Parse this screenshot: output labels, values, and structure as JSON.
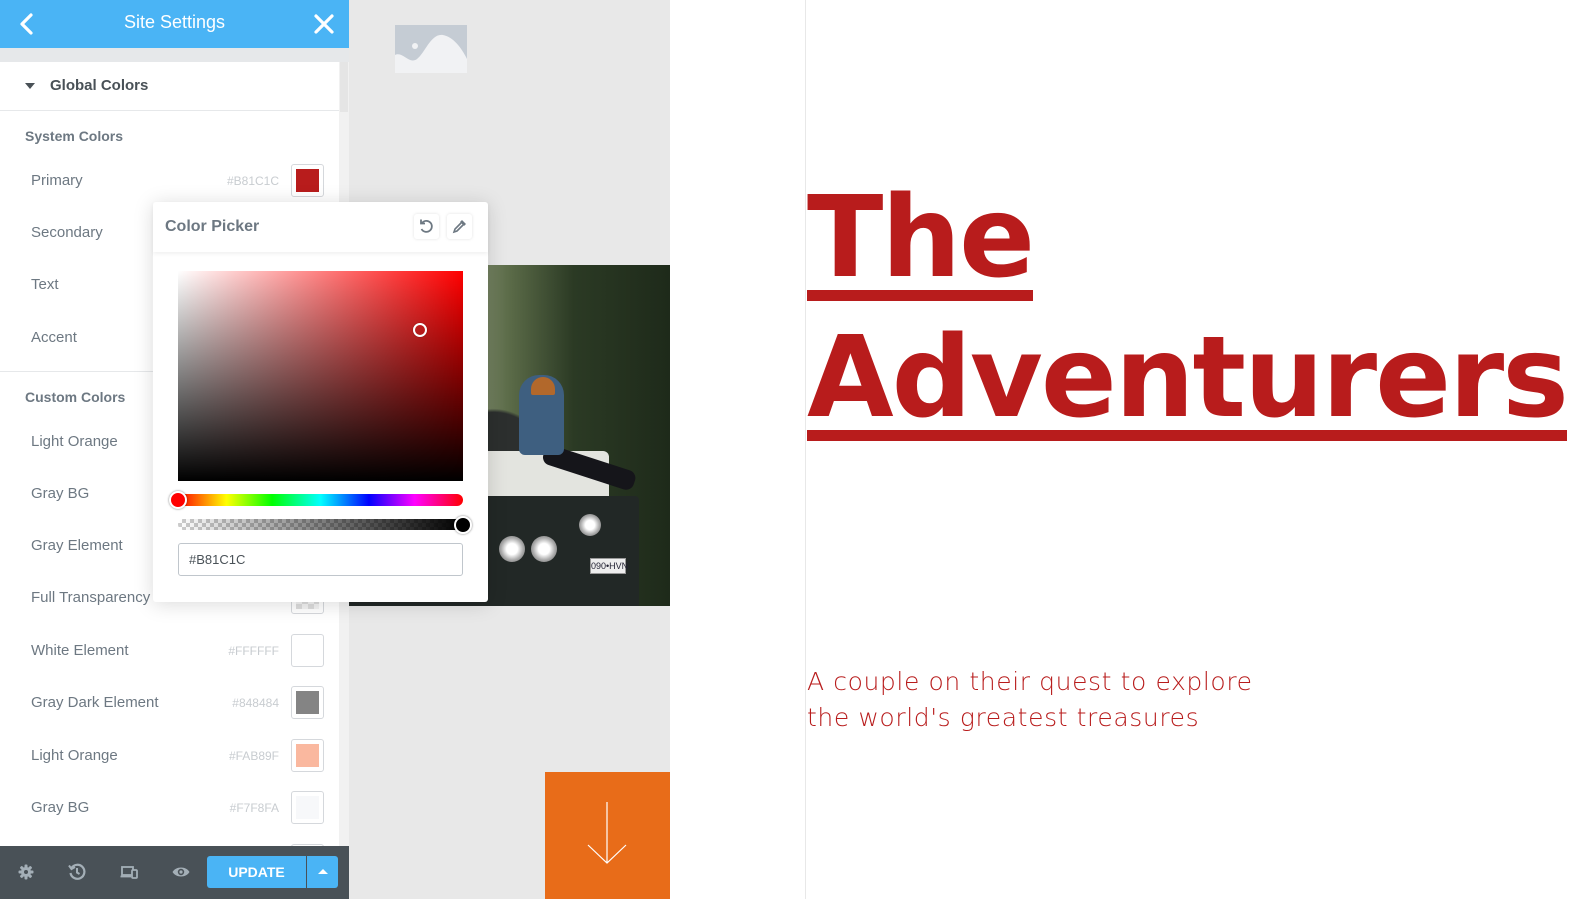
{
  "sidebar": {
    "header": {
      "title": "Site Settings",
      "back_icon": "chevron-left-icon",
      "close_icon": "close-icon"
    },
    "section": {
      "label": "Global Colors",
      "expanded": true
    },
    "system_colors": {
      "title": "System Colors",
      "items": [
        {
          "name": "Primary",
          "hex": "#B81C1C",
          "color": "#B81C1C"
        },
        {
          "name": "Secondary",
          "hex": "",
          "color": ""
        },
        {
          "name": "Text",
          "hex": "",
          "color": ""
        },
        {
          "name": "Accent",
          "hex": "",
          "color": ""
        }
      ]
    },
    "custom_colors": {
      "title": "Custom Colors",
      "items": [
        {
          "name": "Light Orange",
          "hex": "",
          "color": ""
        },
        {
          "name": "Gray BG",
          "hex": "",
          "color": ""
        },
        {
          "name": "Gray Element",
          "hex": "",
          "color": ""
        },
        {
          "name": "Full Transparency",
          "hex": "",
          "color": ""
        },
        {
          "name": "White Element",
          "hex": "#FFFFFF",
          "color": "#FFFFFF"
        },
        {
          "name": "Gray Dark Element",
          "hex": "#848484",
          "color": "#848484"
        },
        {
          "name": "Light Orange",
          "hex": "#FAB89F",
          "color": "#FAB89F"
        },
        {
          "name": "Gray BG",
          "hex": "#F7F8FA",
          "color": "#F7F8FA"
        }
      ]
    },
    "footer": {
      "icons": [
        "settings-icon",
        "history-icon",
        "responsive-icon",
        "preview-eye-icon"
      ],
      "update_label": "UPDATE",
      "update_more_icon": "caret-up-icon"
    }
  },
  "color_picker": {
    "title": "Color Picker",
    "reset_icon": "reset-icon",
    "eyedropper_icon": "eyedropper-icon",
    "hex_value": "#B81C1C",
    "hue": 0,
    "saturation": 0.85,
    "brightness": 0.72,
    "alpha": 1
  },
  "canvas": {
    "image_placeholder_icon": "image-placeholder-icon",
    "photo_plate": "090•HVN",
    "scroll_down_icon": "arrow-down-icon",
    "hero_title_line1": "The",
    "hero_title_line2": "Adventurers",
    "hero_subtitle_line1": "A couple on their quest to explore",
    "hero_subtitle_line2": "the world's greatest treasures",
    "accent_color": "#E86C19",
    "brand_color": "#B81C1C"
  }
}
